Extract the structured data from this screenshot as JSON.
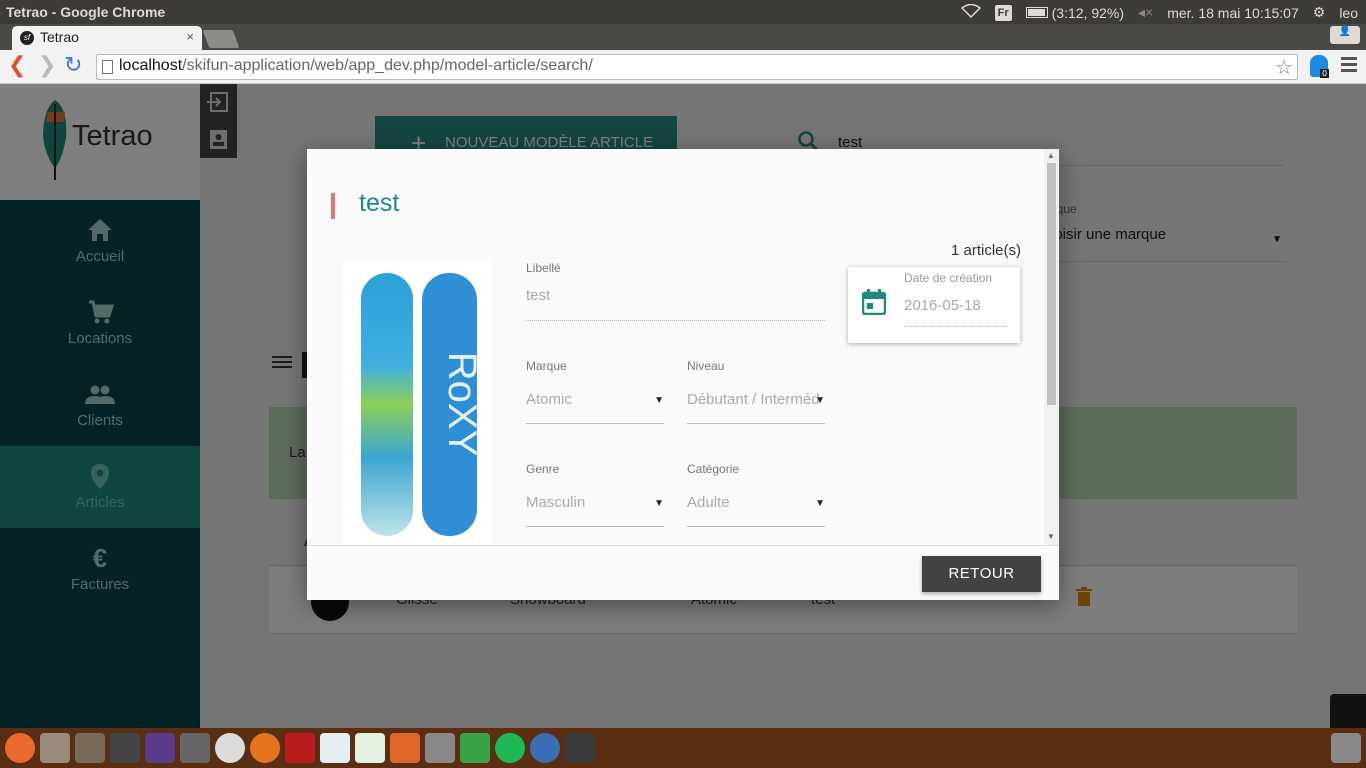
{
  "os_panel": {
    "window_title": "Tetrao - Google Chrome",
    "lang": "Fr",
    "battery": "(3:12, 92%)",
    "datetime": "mer. 18 mai 10:15:07",
    "user": "leo"
  },
  "browser": {
    "tab_title": "Tetrao",
    "url_host": "localhost",
    "url_path": "/skifun-application/web/app_dev.php/model-article/search/",
    "ext_badge": "0"
  },
  "app": {
    "logo": "Tetrao",
    "sidebar": [
      {
        "label": "Accueil",
        "icon": "home-icon"
      },
      {
        "label": "Locations",
        "icon": "cart-icon"
      },
      {
        "label": "Clients",
        "icon": "people-icon"
      },
      {
        "label": "Articles",
        "icon": "location-pin-icon"
      },
      {
        "label": "Factures",
        "icon": "euro-icon"
      }
    ],
    "new_button": "NOUVEAU MODÈLE ARTICLE",
    "search_value": "test",
    "brand_filter": {
      "label": "arque",
      "value": "hoisir une marque"
    },
    "alert_text": "La",
    "table_header_first": "A",
    "row": {
      "c1": "Glisse",
      "c2": "Snowboard",
      "c3": "Atomic",
      "c4": "test"
    }
  },
  "modal": {
    "title": "test",
    "article_count": "1 article(s)",
    "fields": {
      "libelle": {
        "label": "Libellé",
        "value": "test"
      },
      "marque": {
        "label": "Marque",
        "value": "Atomic"
      },
      "niveau": {
        "label": "Niveau",
        "value": "Débutant / Interméd"
      },
      "genre": {
        "label": "Genre",
        "value": "Masculin"
      },
      "categorie": {
        "label": "Catégorie",
        "value": "Adulte"
      },
      "date_creation": {
        "label": "Date de création",
        "value": "2016-05-18"
      }
    },
    "retour_button": "RETOUR"
  },
  "colors": {
    "accent": "#218a80",
    "sidebar": "#08454a",
    "title_bar": "#e57373"
  }
}
